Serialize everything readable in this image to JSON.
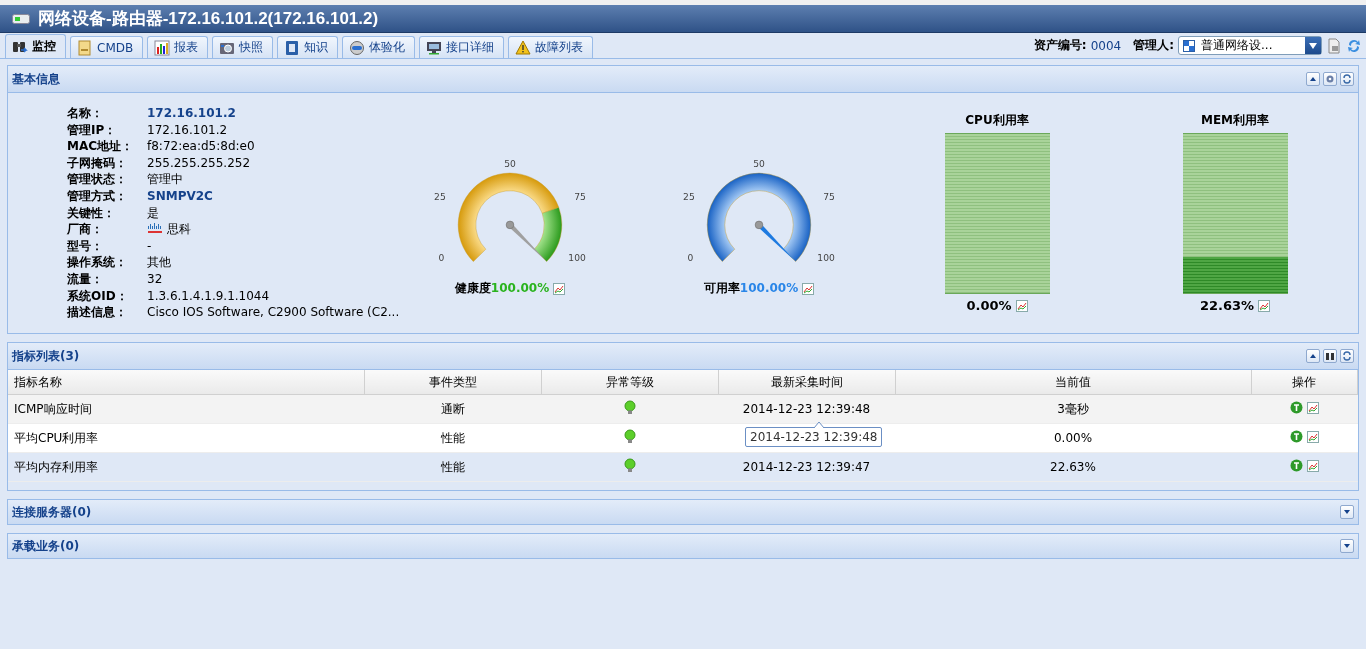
{
  "window": {
    "title": "网络设备-路由器-172.16.101.2(172.16.101.2)"
  },
  "tabs": [
    {
      "label": "监控",
      "selected": true
    },
    {
      "label": "CMDB",
      "selected": false
    },
    {
      "label": "报表",
      "selected": false
    },
    {
      "label": "快照",
      "selected": false
    },
    {
      "label": "知识",
      "selected": false
    },
    {
      "label": "体验化",
      "selected": false
    },
    {
      "label": "接口详细",
      "selected": false
    },
    {
      "label": "故障列表",
      "selected": false
    }
  ],
  "toolbar": {
    "asset_label": "资产编号:",
    "asset_value": "0004",
    "manager_label": "管理人:",
    "manager_select": {
      "value": "普通网络设..."
    }
  },
  "basic_info": {
    "title": "基本信息",
    "expanded": true,
    "fields": [
      {
        "label": "名称：",
        "value": "172.16.101.2",
        "kind": "emphasis"
      },
      {
        "label": "管理IP：",
        "value": "172.16.101.2",
        "kind": "plain"
      },
      {
        "label": "MAC地址：",
        "value": "f8:72:ea:d5:8d:e0",
        "kind": "plain"
      },
      {
        "label": "子网掩码：",
        "value": "255.255.255.252",
        "kind": "plain"
      },
      {
        "label": "管理状态：",
        "value": "管理中",
        "kind": "plain"
      },
      {
        "label": "管理方式：",
        "value": "SNMPV2C",
        "kind": "emphasis"
      },
      {
        "label": "关键性：",
        "value": "是",
        "kind": "plain"
      },
      {
        "label": "厂商：",
        "value": "思科",
        "kind": "vendor"
      },
      {
        "label": "型号：",
        "value": "-",
        "kind": "plain"
      },
      {
        "label": "操作系统：",
        "value": "其他",
        "kind": "plain"
      },
      {
        "label": "流量：",
        "value": "32",
        "kind": "plain"
      },
      {
        "label": "系统OID：",
        "value": "1.3.6.1.4.1.9.1.1044",
        "kind": "plain"
      },
      {
        "label": "描述信息：",
        "value": "Cisco IOS Software, C2900 Software (C2...",
        "kind": "plain"
      }
    ],
    "gauges": [
      {
        "kind": "health",
        "label": "健康度",
        "value": "100.00%",
        "level": 1.0,
        "ticks": [
          "0",
          "25",
          "50",
          "75",
          "100"
        ]
      },
      {
        "kind": "availability",
        "label": "可用率",
        "value": "100.00%",
        "level": 1.0,
        "ticks": [
          "0",
          "25",
          "50",
          "75",
          "100"
        ]
      }
    ],
    "bars": [
      {
        "title": "CPU利用率",
        "value": "0.00%",
        "level": 0.0
      },
      {
        "title": "MEM利用率",
        "value": "22.63%",
        "level": 0.2263
      }
    ]
  },
  "metrics": {
    "title": "指标列表(3)",
    "expanded": true,
    "columns": [
      "指标名称",
      "事件类型",
      "异常等级",
      "最新采集时间",
      "当前值",
      "操作"
    ],
    "rows": [
      {
        "name": "ICMP响应时间",
        "event_type": "通断",
        "time": "2014-12-23 12:39:48",
        "value": "3毫秒",
        "selected": false
      },
      {
        "name": "平均CPU利用率",
        "event_type": "性能",
        "value": "0.00%",
        "selected": false
      },
      {
        "name": "平均内存利用率",
        "event_type": "性能",
        "time": "2014-12-23 12:39:47",
        "value": "22.63%",
        "selected": true
      }
    ],
    "tooltip": "2014-12-23 12:39:48"
  },
  "collapsed_panels": [
    {
      "title": "连接服务器(0)",
      "expanded": false
    },
    {
      "title": "承载业务(0)",
      "expanded": false
    }
  ]
}
